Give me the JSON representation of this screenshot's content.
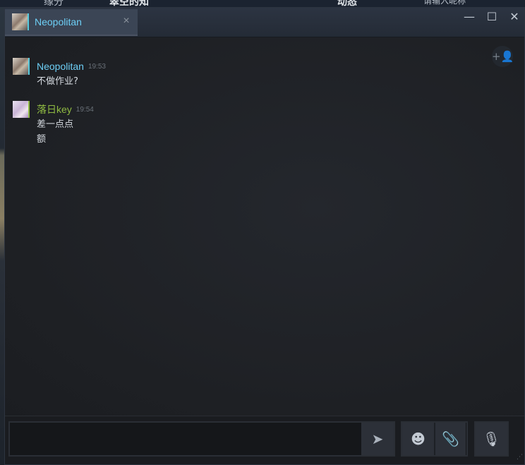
{
  "background": {
    "texts": [
      "缘分",
      "翠空的知",
      "动态",
      "请输入昵称"
    ]
  },
  "window": {
    "tab": {
      "name": "Neopolitan",
      "avatar_icon": "user-avatar",
      "close": "×"
    },
    "controls": {
      "minimize": "—",
      "maximize": "☐",
      "close": "✕"
    }
  },
  "chat": {
    "friends_icon": "+👤",
    "messages": [
      {
        "sender": "Neopolitan",
        "time": "19:53",
        "color": "#6dcff6",
        "lines": [
          "不做作业?"
        ]
      },
      {
        "sender": "落日key",
        "time": "19:54",
        "color": "#8fba42",
        "lines": [
          "差一点点",
          "额"
        ]
      }
    ]
  },
  "input": {
    "value": "",
    "placeholder": "",
    "send_icon": "➤",
    "emoji_icon": "☻",
    "attach_icon": "📎",
    "voice_icon": "🎙"
  }
}
